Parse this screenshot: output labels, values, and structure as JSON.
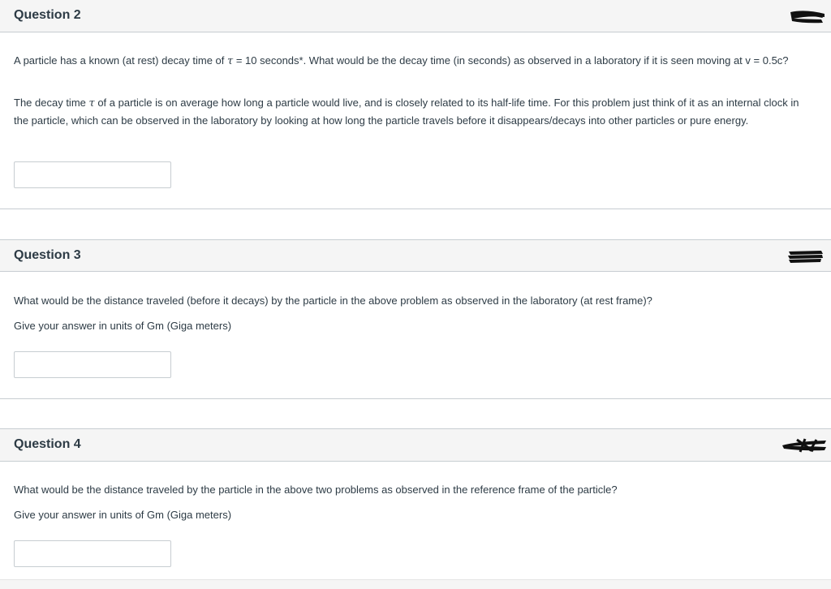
{
  "questions": [
    {
      "title": "Question 2",
      "text_parts": {
        "a": "A particle has a known (at rest) decay time of ",
        "tau": "τ",
        "b": " = 10 seconds*. What would be the decay time (in seconds) as observed in a laboratory if it is seen moving at  v = 0.5c?"
      },
      "para2_parts": {
        "a": "The decay time ",
        "tau": "τ",
        "b": " of a particle is on average how long a particle would live, and is closely related to its half-life time. For this problem just think of it as an internal clock in the particle, which can be observed in the laboratory by looking at how long the particle travels before it disappears/decays into other particles or pure energy."
      },
      "answer_value": ""
    },
    {
      "title": "Question 3",
      "text": "What would be the distance traveled (before it decays) by the particle in the above problem as observed in the laboratory (at rest frame)?",
      "units_text": "Give your answer in units of Gm (Giga meters)",
      "answer_value": ""
    },
    {
      "title": "Question 4",
      "text": "What would be the distance traveled by the particle in the above two problems as observed in the reference frame of the particle?",
      "units_text": "Give your answer in units of Gm (Giga meters)",
      "answer_value": ""
    }
  ],
  "colors": {
    "header_bg": "#f5f5f5",
    "border": "#c7cdd1",
    "text": "#2d3b45",
    "redaction": "#111111"
  },
  "icons": [
    "redaction-mark-icon"
  ]
}
